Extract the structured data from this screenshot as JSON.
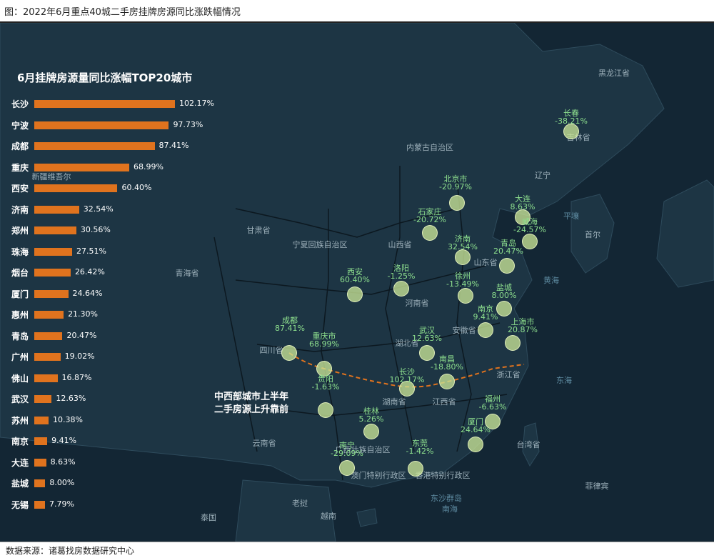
{
  "header": {
    "title": "图：2022年6月重点40城二手房挂牌房源同比涨跌幅情况"
  },
  "footer": {
    "source": "数据来源：诸葛找房数据研究中心"
  },
  "colors": {
    "bar": "#e0731e",
    "map_bg": "#132634",
    "marker": "#c8e496",
    "label": "#8ee08e",
    "trend_line": "#e0731e"
  },
  "panel": {
    "title": "6月挂牌房源量同比涨幅TOP20城市"
  },
  "annotation": {
    "line1": "中西部城市上半年",
    "line2": "二手房源上升靠前"
  },
  "chart_data": {
    "type": "bar",
    "title": "6月挂牌房源量同比涨幅TOP20城市",
    "orientation": "horizontal",
    "categories": [
      "长沙",
      "宁波",
      "成都",
      "重庆",
      "西安",
      "济南",
      "郑州",
      "珠海",
      "烟台",
      "厦门",
      "惠州",
      "青岛",
      "广州",
      "佛山",
      "武汉",
      "苏州",
      "南京",
      "大连",
      "盐城",
      "无锡"
    ],
    "values": [
      102.17,
      97.73,
      87.41,
      68.99,
      60.4,
      32.54,
      30.56,
      27.51,
      26.42,
      24.64,
      21.3,
      20.47,
      19.02,
      16.87,
      12.63,
      10.38,
      9.41,
      8.63,
      8.0,
      7.79
    ],
    "labels": [
      "102.17%",
      "97.73%",
      "87.41%",
      "68.99%",
      "60.40%",
      "32.54%",
      "30.56%",
      "27.51%",
      "26.42%",
      "24.64%",
      "21.30%",
      "20.47%",
      "19.02%",
      "16.87%",
      "12.63%",
      "10.38%",
      "9.41%",
      "8.63%",
      "8.00%",
      "7.79%"
    ],
    "unit": "%"
  },
  "map": {
    "regions": [
      "内蒙古自治区",
      "辽宁",
      "甘肃省",
      "宁夏回族自治区",
      "山西省",
      "山东省",
      "青海省",
      "河南省",
      "安徽省",
      "湖北省",
      "四川省",
      "江西省",
      "湖南省",
      "云南省",
      "广西壮族自治区",
      "台湾省",
      "黑龙江省",
      "吉林省",
      "浙江省",
      "澳门特别行政区",
      "香港特别行政区",
      "新疆维吾尔",
      "老挝",
      "越南",
      "泰国",
      "菲律宾",
      "首尔"
    ],
    "waters": [
      "黄海",
      "东海",
      "南海",
      "东沙群岛",
      "平壤"
    ],
    "cities": [
      {
        "name": "长春",
        "value": "-38.21%"
      },
      {
        "name": "北京市",
        "value": "-20.97%"
      },
      {
        "name": "大连",
        "value": "8.63%"
      },
      {
        "name": "威海",
        "value": "-24.57%"
      },
      {
        "name": "石家庄",
        "value": "-20.72%"
      },
      {
        "name": "济南",
        "value": "32.54%"
      },
      {
        "name": "青岛",
        "value": "20.47%"
      },
      {
        "name": "西安",
        "value": "60.40%"
      },
      {
        "name": "洛阳",
        "value": "-1.25%"
      },
      {
        "name": "徐州",
        "value": "-13.49%"
      },
      {
        "name": "盐城",
        "value": "8.00%"
      },
      {
        "name": "南京",
        "value": "9.41%"
      },
      {
        "name": "上海市",
        "value": "20.87%"
      },
      {
        "name": "成都",
        "value": "87.41%"
      },
      {
        "name": "重庆市",
        "value": "68.99%"
      },
      {
        "name": "武汉",
        "value": "12.63%"
      },
      {
        "name": "南昌",
        "value": "-18.80%"
      },
      {
        "name": "长沙",
        "value": "102.17%"
      },
      {
        "name": "贵阳",
        "value": "-1.63%"
      },
      {
        "name": "福州",
        "value": "-6.63%"
      },
      {
        "name": "厦门",
        "value": "24.64%"
      },
      {
        "name": "桂林",
        "value": "5.26%"
      },
      {
        "name": "南宁",
        "value": "-29.09%"
      },
      {
        "name": "东莞",
        "value": "-1.42%"
      }
    ]
  }
}
